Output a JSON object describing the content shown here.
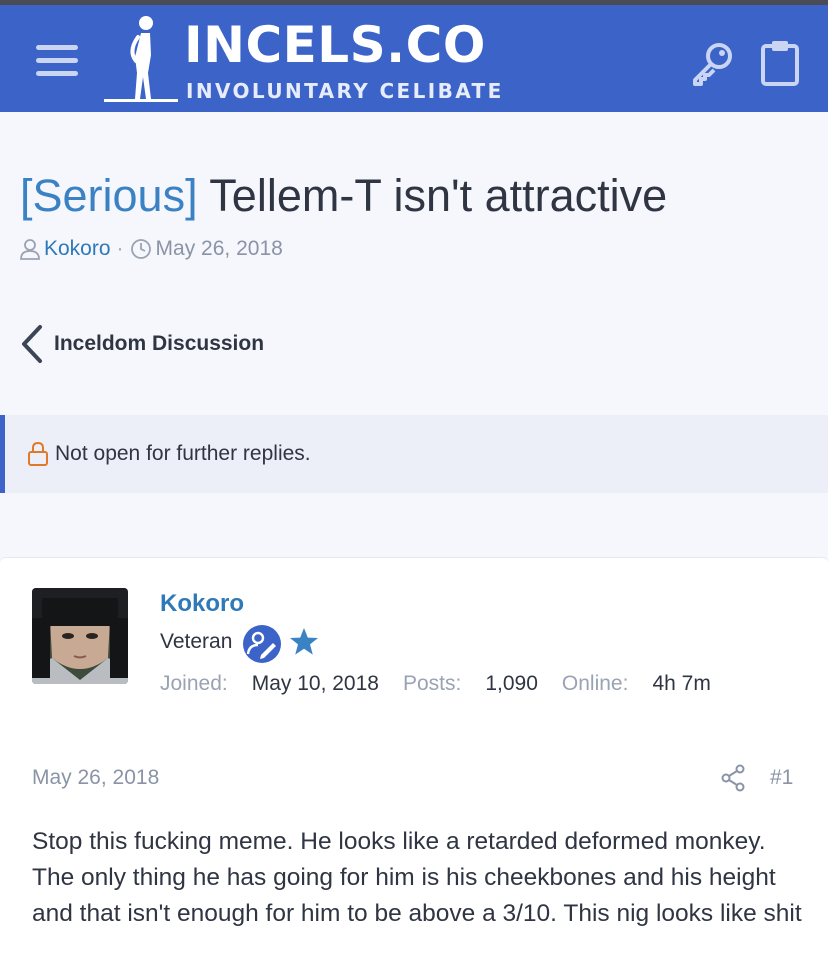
{
  "header": {
    "logo_title": "INCELS.CO",
    "logo_subtitle": "INVOLUNTARY CELIBATE"
  },
  "thread": {
    "prefix": "[Serious]",
    "title": "Tellem-T isn't attractive",
    "author": "Kokoro",
    "date": "May 26, 2018",
    "breadcrumb": "Inceldom Discussion",
    "locked_notice": "Not open for further replies."
  },
  "post": {
    "username": "Kokoro",
    "user_title": "Veteran",
    "joined_label": "Joined:",
    "joined_value": "May 10, 2018",
    "posts_label": "Posts:",
    "posts_value": "1,090",
    "online_label": "Online:",
    "online_value": "4h 7m",
    "date": "May 26, 2018",
    "number": "#1",
    "body": "Stop this fucking meme. He looks like a retarded deformed monkey. The only thing he has going for him is his cheekbones and his height and that isn't enough for him to be above a 3/10. This nig looks like shit"
  },
  "icons": [
    "menu-icon",
    "logo-figure-icon",
    "key-icon",
    "clipboard-icon",
    "user-icon",
    "clock-icon",
    "chevron-left-icon",
    "lock-icon",
    "user-edit-badge-icon",
    "star-icon",
    "share-icon"
  ],
  "colors": {
    "header_bg": "#3c63c8",
    "link": "#2f79b9",
    "prefix": "#3b82c4",
    "lock": "#e07a2a"
  }
}
